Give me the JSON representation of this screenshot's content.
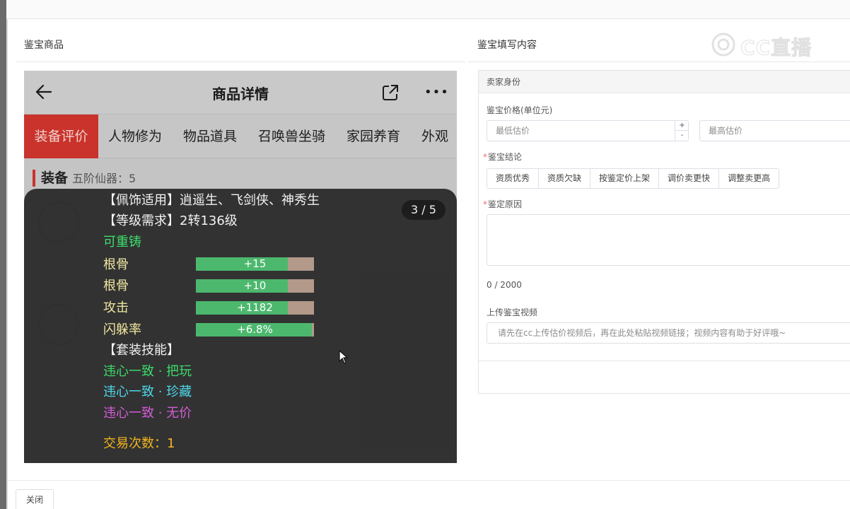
{
  "left_panel": {
    "title": "鉴宝商品"
  },
  "right_panel": {
    "title": "鉴宝填写内容"
  },
  "watermark": {
    "text": "CC直播"
  },
  "phone": {
    "header_title": "商品详情",
    "more_label": "•••",
    "tabs": [
      {
        "label": "装备评价",
        "active": true
      },
      {
        "label": "人物修为"
      },
      {
        "label": "物品道具"
      },
      {
        "label": "召唤兽坐骑"
      },
      {
        "label": "家园养育"
      },
      {
        "label": "外观"
      }
    ],
    "section": {
      "title": "装备",
      "subtitle": "五阶仙器：5"
    },
    "overlay": {
      "counter": "3 / 5",
      "lines": [
        "【佩饰适用】逍遥生、飞剑侠、神秀生",
        "【等级需求】2转136级",
        "可重铸"
      ],
      "stats": [
        {
          "label": "根骨",
          "value": "+15",
          "fill": 0.78
        },
        {
          "label": "根骨",
          "value": "+10",
          "fill": 0.78
        },
        {
          "label": "攻击",
          "value": "+1182",
          "fill": 0.78
        },
        {
          "label": "闪躲率",
          "value": "+6.8%",
          "fill": 0.98
        }
      ],
      "set_title": "【套装技能】",
      "skills": [
        {
          "text": "违心一致 · 把玩",
          "color": "#3ddc6a"
        },
        {
          "text": "违心一致 · 珍藏",
          "color": "#4fd8ea"
        },
        {
          "text": "违心一致 · 无价",
          "color": "#d45cd8"
        }
      ],
      "trade_count": "交易次数：1"
    }
  },
  "form": {
    "section_header": "卖家身份",
    "price_label": "鉴宝价格(单位元)",
    "min_placeholder": "最低估价",
    "max_placeholder": "最高估价",
    "stepper_up": "+",
    "stepper_down": "-",
    "conclusion_label": "鉴宝结论",
    "conclusion_options": [
      "资质优秀",
      "资质欠缺",
      "按鉴定价上架",
      "调价卖更快",
      "调整卖更高"
    ],
    "reason_label": "鉴定原因",
    "reason_count": "0 / 2000",
    "video_label": "上传鉴宝视频",
    "video_placeholder": "请先在cc上传估价视频后，再在此处粘贴视频链接；视频内容有助于好评哦~",
    "required_mark": "*"
  },
  "footer": {
    "close_label": "关闭"
  },
  "colors": {
    "accent_red": "#c9332c",
    "bar_green": "#4cb86e",
    "bar_bg": "#b2998a"
  }
}
